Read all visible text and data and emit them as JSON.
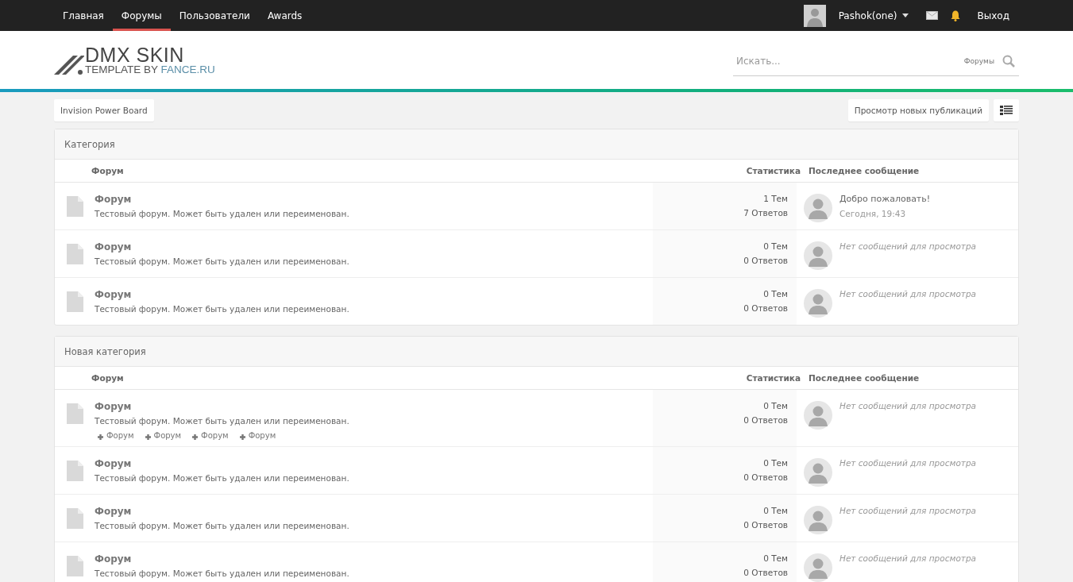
{
  "top_nav": {
    "items": [
      {
        "label": "Главная",
        "selected": false
      },
      {
        "label": "Форумы",
        "selected": true
      },
      {
        "label": "Пользователи",
        "selected": false
      },
      {
        "label": "Awards",
        "selected": false
      }
    ],
    "user": {
      "name": "Pashok(one)"
    },
    "logout": "Выход"
  },
  "logo": {
    "title": "DMX SKIN",
    "subtitle": "TEMPLATE BY",
    "domain": "FANCE.RU"
  },
  "search": {
    "placeholder": "Искать...",
    "scope": "Форумы"
  },
  "breadcrumb": [
    "Invision Power Board"
  ],
  "new_content_button": "Просмотр новых публикаций",
  "categories": [
    {
      "title": "Категория",
      "columns": {
        "forum": "Форум",
        "stats": "Статистика",
        "last_post": "Последнее сообщение"
      },
      "forums": [
        {
          "name": "Форум",
          "description": "Тестовый форум. Может быть удален или переименован.",
          "topics": "1 Тем",
          "replies": "7 Ответов",
          "last_post": {
            "kind": "post",
            "title": "Добро пожаловать!",
            "time": "Сегодня, 19:43"
          }
        },
        {
          "name": "Форум",
          "description": "Тестовый форум. Может быть удален или переименован.",
          "topics": "0 Тем",
          "replies": "0 Ответов",
          "last_post": {
            "kind": "empty",
            "text": "Нет сообщений для просмотра"
          }
        },
        {
          "name": "Форум",
          "description": "Тестовый форум. Может быть удален или переименован.",
          "topics": "0 Тем",
          "replies": "0 Ответов",
          "last_post": {
            "kind": "empty",
            "text": "Нет сообщений для просмотра"
          }
        }
      ]
    },
    {
      "title": "Новая категория",
      "columns": {
        "forum": "Форум",
        "stats": "Статистика",
        "last_post": "Последнее сообщение"
      },
      "forums": [
        {
          "name": "Форум",
          "description": "Тестовый форум. Может быть удален или переименован.",
          "subforums": [
            "Форум",
            "Форум",
            "Форум",
            "Форум"
          ],
          "topics": "0 Тем",
          "replies": "0 Ответов",
          "last_post": {
            "kind": "empty",
            "text": "Нет сообщений для просмотра"
          }
        },
        {
          "name": "Форум",
          "description": "Тестовый форум. Может быть удален или переименован.",
          "topics": "0 Тем",
          "replies": "0 Ответов",
          "last_post": {
            "kind": "empty",
            "text": "Нет сообщений для просмотра"
          }
        },
        {
          "name": "Форум",
          "description": "Тестовый форум. Может быть удален или переименован.",
          "topics": "0 Тем",
          "replies": "0 Ответов",
          "last_post": {
            "kind": "empty",
            "text": "Нет сообщений для просмотра"
          }
        },
        {
          "name": "Форум",
          "description": "Тестовый форум. Может быть удален или переименован.",
          "topics": "0 Тем",
          "replies": "0 Ответов",
          "last_post": {
            "kind": "empty",
            "text": "Нет сообщений для просмотра"
          }
        }
      ]
    }
  ]
}
